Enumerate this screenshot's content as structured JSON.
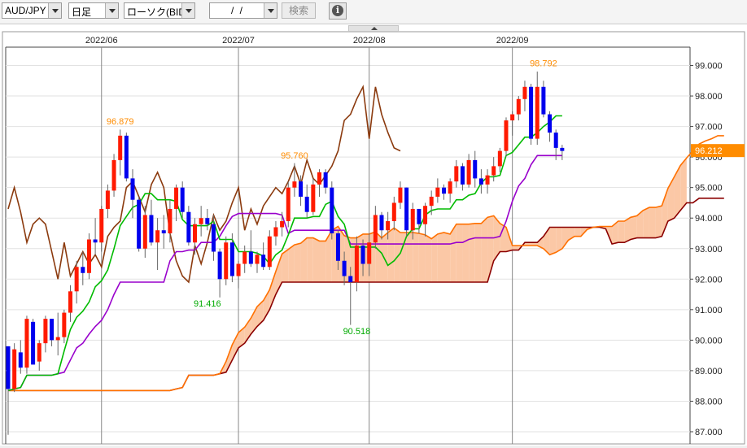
{
  "toolbar": {
    "pair": "AUD/JPY",
    "period": "日足",
    "chart_type": "ローソク(BID)",
    "date": "/ /",
    "search_label": "検索",
    "info_icon": "info-icon"
  },
  "colors": {
    "up_candle": "#ff1a00",
    "down_candle": "#0000ee",
    "cloud_fill": "#fbc8a6",
    "senkou_a": "#ff7000",
    "senkou_b": "#8b0000",
    "tenkan": "#9900cc",
    "kijun": "#00bb00",
    "chikou": "#8b3a0e",
    "price_tag": "#ff8c00"
  },
  "chart_data": {
    "type": "candlestick",
    "y_ticks": [
      "99.000",
      "98.000",
      "97.000",
      "96.000",
      "95.000",
      "94.000",
      "93.000",
      "92.000",
      "91.000",
      "90.000",
      "89.000",
      "88.000",
      "87.000"
    ],
    "y_range": [
      86.6,
      99.6
    ],
    "x_labels": [
      {
        "label": "2022/06",
        "index": 15
      },
      {
        "label": "2022/07",
        "index": 37
      },
      {
        "label": "2022/08",
        "index": 58
      },
      {
        "label": "2022/09",
        "index": 81
      }
    ],
    "current_price": "96.212",
    "annotations": [
      {
        "text": "96.879",
        "index": 18,
        "value": 96.879,
        "color": "#ff8c00"
      },
      {
        "text": "95.760",
        "index": 46,
        "value": 95.76,
        "color": "#ff8c00"
      },
      {
        "text": "98.792",
        "index": 86,
        "value": 98.792,
        "color": "#ff8c00"
      },
      {
        "text": "91.416",
        "index": 32,
        "value": 91.416,
        "color": "#00aa00"
      },
      {
        "text": "90.518",
        "index": 56,
        "value": 90.518,
        "color": "#00aa00"
      }
    ],
    "candles": [
      [
        89.8,
        89.8,
        86.9,
        88.4
      ],
      [
        88.4,
        89.9,
        88.3,
        89.7
      ],
      [
        89.6,
        90.0,
        88.9,
        89.1
      ],
      [
        89.1,
        90.8,
        88.9,
        90.7
      ],
      [
        90.6,
        90.7,
        89.2,
        89.2
      ],
      [
        89.3,
        90.0,
        89.0,
        89.9
      ],
      [
        89.9,
        90.8,
        89.6,
        90.7
      ],
      [
        90.7,
        90.7,
        89.8,
        90.0
      ],
      [
        90.0,
        90.9,
        89.5,
        90.1
      ],
      [
        90.1,
        91.0,
        89.9,
        90.9
      ],
      [
        90.9,
        91.8,
        90.6,
        91.6
      ],
      [
        91.6,
        92.6,
        91.2,
        92.4
      ],
      [
        92.4,
        92.9,
        91.8,
        92.2
      ],
      [
        92.2,
        93.5,
        92.0,
        93.3
      ],
      [
        93.3,
        94.0,
        92.8,
        93.2
      ],
      [
        93.2,
        94.4,
        92.9,
        94.3
      ],
      [
        94.3,
        95.1,
        94.0,
        94.9
      ],
      [
        94.9,
        96.1,
        94.7,
        95.9
      ],
      [
        95.9,
        96.9,
        95.4,
        96.7
      ],
      [
        96.7,
        96.8,
        95.2,
        95.3
      ],
      [
        95.3,
        95.6,
        94.0,
        94.6
      ],
      [
        94.6,
        94.7,
        92.9,
        93.0
      ],
      [
        93.0,
        94.4,
        92.7,
        94.1
      ],
      [
        94.1,
        94.6,
        93.1,
        93.2
      ],
      [
        93.2,
        94.0,
        92.3,
        93.6
      ],
      [
        93.6,
        94.1,
        93.0,
        93.5
      ],
      [
        93.5,
        94.6,
        93.2,
        94.3
      ],
      [
        94.3,
        95.1,
        93.9,
        95.0
      ],
      [
        95.0,
        95.2,
        94.0,
        94.2
      ],
      [
        94.2,
        94.4,
        93.1,
        93.2
      ],
      [
        93.2,
        94.0,
        92.8,
        93.8
      ],
      [
        93.8,
        94.4,
        93.4,
        94.0
      ],
      [
        94.0,
        94.3,
        93.6,
        93.8
      ],
      [
        93.8,
        94.1,
        92.6,
        92.9
      ],
      [
        92.9,
        93.0,
        91.4,
        92.0
      ],
      [
        92.0,
        93.4,
        91.8,
        93.2
      ],
      [
        93.2,
        93.5,
        91.9,
        92.1
      ],
      [
        92.1,
        92.6,
        91.7,
        92.5
      ],
      [
        92.5,
        93.1,
        92.2,
        92.9
      ],
      [
        92.9,
        93.6,
        92.4,
        92.5
      ],
      [
        92.5,
        92.9,
        92.2,
        92.8
      ],
      [
        92.8,
        93.2,
        92.3,
        92.4
      ],
      [
        92.4,
        93.6,
        92.3,
        93.4
      ],
      [
        93.4,
        93.9,
        93.1,
        93.7
      ],
      [
        93.7,
        94.2,
        93.4,
        93.9
      ],
      [
        93.9,
        95.2,
        93.7,
        95.0
      ],
      [
        95.0,
        95.8,
        94.7,
        95.2
      ],
      [
        95.2,
        95.4,
        94.4,
        94.7
      ],
      [
        94.7,
        95.1,
        94.0,
        94.2
      ],
      [
        94.2,
        95.3,
        94.1,
        95.1
      ],
      [
        95.1,
        95.6,
        94.7,
        95.5
      ],
      [
        95.5,
        95.6,
        94.8,
        95.0
      ],
      [
        95.0,
        95.2,
        93.3,
        93.5
      ],
      [
        93.5,
        93.6,
        92.3,
        92.6
      ],
      [
        92.6,
        92.9,
        91.8,
        92.1
      ],
      [
        92.1,
        92.4,
        90.5,
        91.9
      ],
      [
        91.9,
        93.4,
        91.6,
        93.1
      ],
      [
        93.1,
        93.3,
        92.1,
        92.5
      ],
      [
        92.5,
        93.5,
        92.1,
        93.2
      ],
      [
        93.2,
        94.4,
        93.0,
        94.1
      ],
      [
        94.1,
        94.2,
        93.3,
        93.6
      ],
      [
        93.6,
        94.2,
        93.3,
        93.9
      ],
      [
        93.9,
        94.7,
        93.6,
        94.5
      ],
      [
        94.5,
        95.2,
        94.3,
        95.0
      ],
      [
        95.0,
        95.0,
        93.4,
        93.6
      ],
      [
        93.6,
        94.5,
        93.3,
        94.3
      ],
      [
        94.3,
        94.3,
        93.5,
        93.8
      ],
      [
        93.8,
        94.5,
        93.4,
        94.4
      ],
      [
        94.4,
        94.9,
        94.1,
        94.7
      ],
      [
        94.7,
        95.3,
        94.5,
        95.0
      ],
      [
        95.0,
        95.1,
        94.6,
        94.8
      ],
      [
        94.8,
        95.3,
        94.5,
        95.2
      ],
      [
        95.2,
        95.9,
        95.0,
        95.7
      ],
      [
        95.7,
        95.8,
        94.9,
        95.1
      ],
      [
        95.1,
        96.1,
        95.0,
        95.9
      ],
      [
        95.9,
        96.2,
        95.0,
        95.3
      ],
      [
        95.3,
        95.6,
        94.8,
        95.1
      ],
      [
        95.1,
        95.6,
        94.8,
        95.4
      ],
      [
        95.4,
        96.0,
        95.2,
        95.7
      ],
      [
        95.7,
        96.3,
        95.5,
        96.2
      ],
      [
        96.2,
        97.3,
        96.0,
        97.2
      ],
      [
        97.2,
        97.5,
        96.7,
        97.4
      ],
      [
        97.4,
        98.0,
        97.2,
        97.9
      ],
      [
        97.9,
        98.5,
        97.5,
        98.3
      ],
      [
        98.3,
        98.4,
        96.4,
        96.6
      ],
      [
        96.6,
        98.8,
        96.4,
        98.3
      ],
      [
        98.3,
        98.5,
        97.3,
        97.4
      ],
      [
        97.4,
        97.5,
        96.5,
        96.8
      ],
      [
        96.8,
        96.9,
        95.9,
        96.3
      ],
      [
        96.3,
        96.4,
        95.9,
        96.2
      ]
    ]
  }
}
